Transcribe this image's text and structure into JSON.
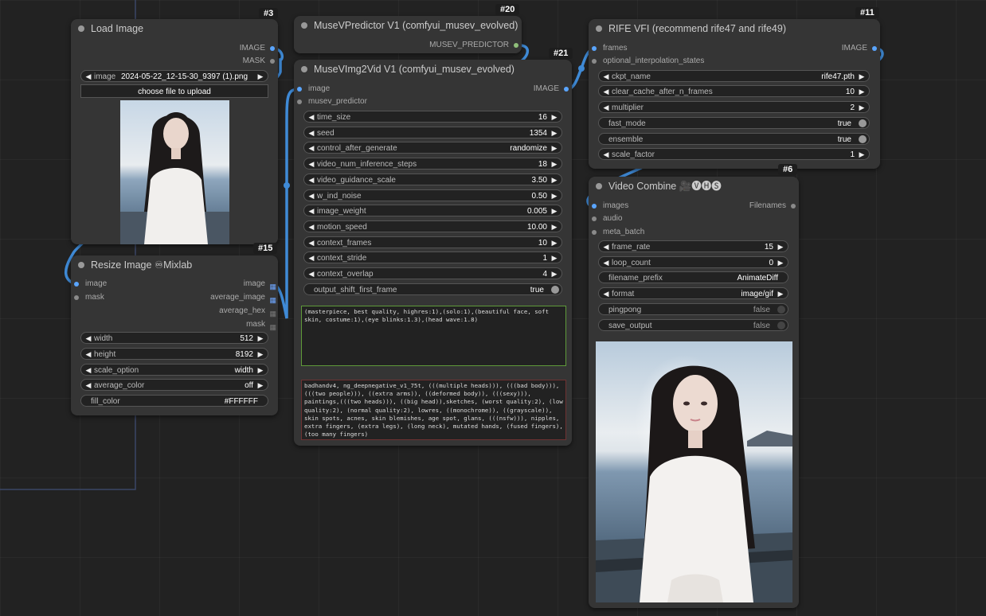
{
  "nodes": {
    "load_image": {
      "id": "#3",
      "title": "Load Image",
      "outputs": [
        "IMAGE",
        "MASK"
      ],
      "image_widget": {
        "label": "image",
        "value": "2024-05-22_12-15-30_9397 (1).png"
      },
      "upload_button": "choose file to upload"
    },
    "resize_image": {
      "id": "#15",
      "title": "Resize Image ♾Mixlab",
      "inputs": [
        "image",
        "mask"
      ],
      "outputs": [
        "image",
        "average_image",
        "average_hex",
        "mask"
      ],
      "widgets": [
        {
          "label": "width",
          "value": "512"
        },
        {
          "label": "height",
          "value": "8192"
        },
        {
          "label": "scale_option",
          "value": "width"
        },
        {
          "label": "average_color",
          "value": "off"
        },
        {
          "label": "fill_color",
          "value": "#FFFFFF"
        }
      ]
    },
    "musev_predictor": {
      "id": "#20",
      "title": "MuseVPredictor V1 (comfyui_musev_evolved)",
      "outputs": [
        "MUSEV_PREDICTOR"
      ]
    },
    "musev_img2vid": {
      "id": "#21",
      "title": "MuseVImg2Vid V1 (comfyui_musev_evolved)",
      "inputs": [
        "image",
        "musev_predictor"
      ],
      "outputs": [
        "IMAGE"
      ],
      "widgets": [
        {
          "label": "time_size",
          "value": "16"
        },
        {
          "label": "seed",
          "value": "1354"
        },
        {
          "label": "control_after_generate",
          "value": "randomize"
        },
        {
          "label": "video_num_inference_steps",
          "value": "18"
        },
        {
          "label": "video_guidance_scale",
          "value": "3.50"
        },
        {
          "label": "w_ind_noise",
          "value": "0.50"
        },
        {
          "label": "image_weight",
          "value": "0.005"
        },
        {
          "label": "motion_speed",
          "value": "10.00"
        },
        {
          "label": "context_frames",
          "value": "10"
        },
        {
          "label": "context_stride",
          "value": "1"
        },
        {
          "label": "context_overlap",
          "value": "4"
        }
      ],
      "toggle": {
        "label": "output_shift_first_frame",
        "value": "true"
      },
      "positive_prompt": "(masterpiece, best quality, highres:1),(solo:1),(beautiful face, soft skin, costume:1),(eye blinks:1.3),(head wave:1.8)",
      "negative_prompt": "badhandv4, ng_deepnegative_v1_75t, (((multiple heads))), (((bad body))), (((two people))), ((extra arms)), ((deformed body)), (((sexy))), paintings,(((two heads))), ((big head)),sketches, (worst quality:2), (low quality:2), (normal quality:2), lowres, ((monochrome)), ((grayscale)), skin spots, acnes, skin blemishes, age spot, glans, (((nsfw))), nipples, extra fingers, (extra legs), (long neck), mutated hands, (fused fingers), (too many fingers)"
    },
    "rife_vfi": {
      "id": "#11",
      "title": "RIFE VFI (recommend rife47 and rife49)",
      "inputs": [
        "frames",
        "optional_interpolation_states"
      ],
      "outputs": [
        "IMAGE"
      ],
      "widgets": [
        {
          "label": "ckpt_name",
          "value": "rife47.pth"
        },
        {
          "label": "clear_cache_after_n_frames",
          "value": "10"
        },
        {
          "label": "multiplier",
          "value": "2"
        }
      ],
      "toggles": [
        {
          "label": "fast_mode",
          "value": "true"
        },
        {
          "label": "ensemble",
          "value": "true"
        }
      ],
      "widget_after": {
        "label": "scale_factor",
        "value": "1"
      }
    },
    "video_combine": {
      "id": "#6",
      "title": "Video Combine 🎥🅥🅗🅢",
      "inputs": [
        "images",
        "audio",
        "meta_batch"
      ],
      "outputs": [
        "Filenames"
      ],
      "widgets": [
        {
          "label": "frame_rate",
          "value": "15"
        },
        {
          "label": "loop_count",
          "value": "0"
        }
      ],
      "filename_prefix": {
        "label": "filename_prefix",
        "value": "AnimateDiff"
      },
      "format": {
        "label": "format",
        "value": "image/gif"
      },
      "toggles": [
        {
          "label": "pingpong",
          "value": "false"
        },
        {
          "label": "save_output",
          "value": "false"
        }
      ]
    }
  },
  "colors": {
    "canvas": "#222222",
    "node": "#353535",
    "link_blue": "#4a90d9",
    "slot_blue": "#5aa5ff",
    "positive_border": "#6a9a3a",
    "negative_border": "#6a3434"
  }
}
